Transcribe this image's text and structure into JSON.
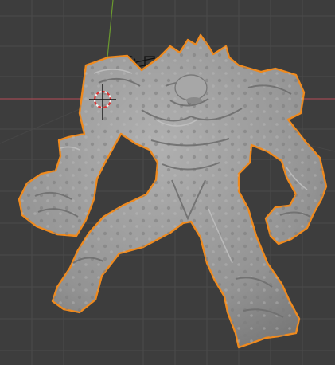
{
  "viewport": {
    "mode": "3d-viewport",
    "background": "#3d3d3d",
    "grid_color": "#4a4a4a",
    "x_axis_color": "#a04a52",
    "y_axis_color": "#6b9a2f"
  },
  "object": {
    "kind": "sculpted-golem-mesh",
    "selected": true,
    "mesh_color": "#9a9a9a",
    "outline_color": "#ef8a1e"
  },
  "gizmos": {
    "cursor": "3d-cursor-icon",
    "camera": "camera-object-icon"
  }
}
